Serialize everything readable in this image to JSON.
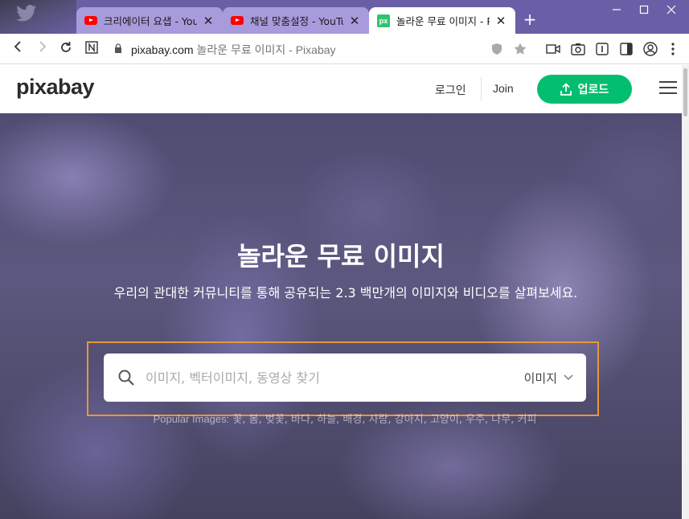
{
  "browser": {
    "tabs": [
      {
        "title": "크리에이터 요샙 - YouTube",
        "favicon": "youtube-icon",
        "active": false
      },
      {
        "title": "채널 맞춤설정 - YouTube",
        "favicon": "youtube-icon",
        "active": false
      },
      {
        "title": "놀라운 무료 이미지 - Pixabay",
        "favicon": "pixabay-icon",
        "active": true
      }
    ],
    "new_tab": "+",
    "address": {
      "domain": "pixabay.com",
      "rest": "놀라운 무료 이미지 - Pixabay"
    },
    "favicon_text": "px"
  },
  "site": {
    "logo": "pixabay",
    "login": "로그인",
    "join": "Join",
    "upload": "업로드"
  },
  "hero": {
    "title": "놀라운 무료 이미지",
    "subtitle": "우리의 관대한 커뮤니티를 통해 공유되는 2.3 백만개의 이미지와 비디오를 살펴보세요.",
    "search_placeholder": "이미지, 벡터이미지, 동영상 찾기",
    "search_type": "이미지",
    "popular_label": "Popular Images:",
    "popular_tags": [
      "꽃",
      "봄",
      "벚꽃",
      "바다",
      "하늘",
      "배경",
      "사람",
      "강아지",
      "고양이",
      "우주",
      "나무",
      "커피"
    ]
  },
  "colors": {
    "accent": "#02be6e",
    "tab_active": "#ffffff",
    "tab_inactive": "#a89bdc",
    "titlebar": "#6a5fa6",
    "search_outline": "#e8963c"
  }
}
